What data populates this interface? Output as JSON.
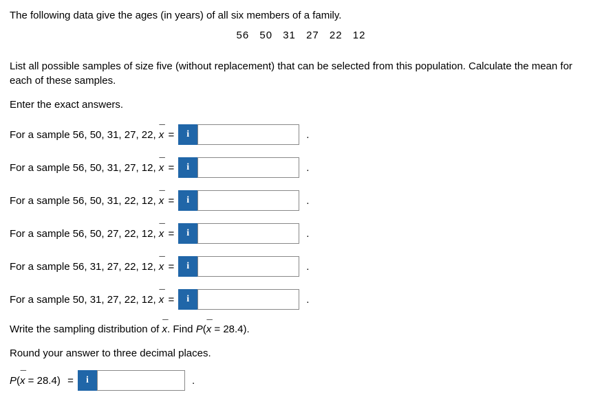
{
  "intro": "The following data give the ages (in years) of all six members of a family.",
  "data_values": "56   50   31   27   22   12",
  "instruction": "List all possible samples of size five (without replacement) that can be selected from this population. Calculate the mean for each of these samples.",
  "sub_instruction": "Enter the exact answers.",
  "samples": [
    {
      "label": "For a sample 56, 50, 31, 27, 22, "
    },
    {
      "label": "For a sample 56, 50, 31, 27, 12, "
    },
    {
      "label": "For a sample 56, 50, 31, 22, 12, "
    },
    {
      "label": "For a sample 56, 50, 27, 22, 12, "
    },
    {
      "label": "For a sample 56, 31, 27, 22, 12, "
    },
    {
      "label": "For a sample 50, 31, 27, 22, 12, "
    }
  ],
  "info_icon": "i",
  "dist_instruction_pre": "Write the sampling distribution of ",
  "dist_instruction_mid": ". Find ",
  "prob_value": "28.4",
  "round_instruction": "Round your answer to three decimal places.",
  "period": "."
}
